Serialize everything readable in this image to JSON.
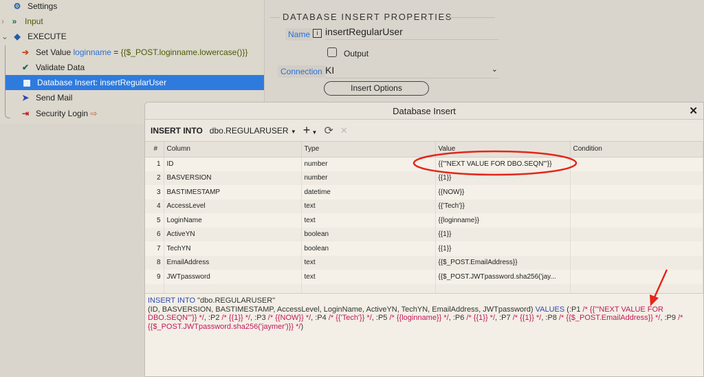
{
  "tree": {
    "items": [
      {
        "label": "Settings",
        "icon": "gear-icon"
      },
      {
        "label": "Input",
        "icon": "chevrons-right-icon"
      },
      {
        "label": "EXECUTE",
        "icon": "box-icon"
      },
      {
        "label": "Set Value",
        "var": "loginname",
        "eq": "=",
        "expr": "{{$_POST.loginname.lowercase()}}",
        "icon": "arrow-circle-icon"
      },
      {
        "label": "Validate Data",
        "icon": "check-icon"
      },
      {
        "label": "Database Insert: insertRegularUser",
        "icon": "table-icon"
      },
      {
        "label": "Send Mail",
        "icon": "paper-plane-icon"
      },
      {
        "label": "Security Login",
        "icon": "login-icon"
      }
    ]
  },
  "props": {
    "title": "DATABASE INSERT PROPERTIES",
    "name_label": "Name",
    "name_value": "insertRegularUser",
    "output_label": "Output",
    "connection_label": "Connection",
    "connection_value": "KI",
    "insert_options": "Insert Options"
  },
  "dialog": {
    "title": "Database Insert",
    "insert_into": "INSERT INTO",
    "table": "dbo.REGULARUSER",
    "headers": [
      "#",
      "Column",
      "Type",
      "Value",
      "Condition"
    ],
    "rows": [
      [
        "1",
        "ID",
        "number",
        "{{'\"NEXT VALUE FOR DBO.SEQN\"'}}",
        ""
      ],
      [
        "2",
        "BASVERSION",
        "number",
        "{{1}}",
        ""
      ],
      [
        "3",
        "BASTIMESTAMP",
        "datetime",
        "{{NOW}}",
        ""
      ],
      [
        "4",
        "AccessLevel",
        "text",
        "{{'Tech'}}",
        ""
      ],
      [
        "5",
        "LoginName",
        "text",
        "{{loginname}}",
        ""
      ],
      [
        "6",
        "ActiveYN",
        "boolean",
        "{{1}}",
        ""
      ],
      [
        "7",
        "TechYN",
        "boolean",
        "{{1}}",
        ""
      ],
      [
        "8",
        "EmailAddress",
        "text",
        "{{$_POST.EmailAddress}}",
        ""
      ],
      [
        "9",
        "JWTpassword",
        "text",
        "{{$_POST.JWTpassword.sha256('jay...",
        ""
      ]
    ],
    "sql": {
      "kw1": "INSERT INTO",
      "tbl": " \"dbo.REGULARUSER\"",
      "cols": "(ID, BASVERSION, BASTIMESTAMP, AccessLevel, LoginName, ActiveYN, TechYN, EmailAddress, JWTpassword) ",
      "kw2": "VALUES",
      "params": [
        [
          " (:P1 ",
          "/* {{'\"NEXT VALUE FOR DBO.SEQN\"'}} */"
        ],
        [
          ", :P2 ",
          "/* {{1}} */"
        ],
        [
          ", :P3 ",
          "/* {{NOW}} */"
        ],
        [
          ", :P4 ",
          "/* {{'Tech'}} */"
        ],
        [
          ", :P5 ",
          "/* {{loginname}} */"
        ],
        [
          ", :P6 ",
          "/* {{1}} */"
        ],
        [
          ", :P7 ",
          "/* {{1}} */"
        ],
        [
          ", :P8 ",
          "/* {{$_POST.EmailAddress}} */"
        ],
        [
          ", :P9 ",
          "/* {{$_POST.JWTpassword.sha256('jaymer')}} */"
        ]
      ],
      "end": ")"
    }
  }
}
